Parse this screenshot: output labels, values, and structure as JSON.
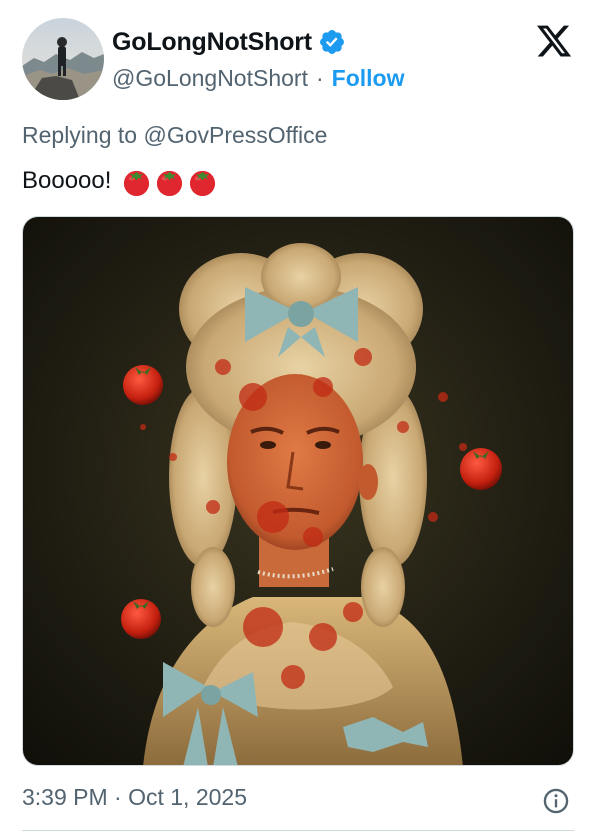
{
  "author": {
    "display_name": "GoLongNotShort",
    "handle": "@GoLongNotShort",
    "separator": "·",
    "follow_label": "Follow",
    "verified": true
  },
  "reply": {
    "prefix": "Replying to ",
    "mention": "@GovPressOffice"
  },
  "tweet": {
    "text": "Booooo!",
    "emoji": [
      "tomato",
      "tomato",
      "tomato"
    ]
  },
  "media": {
    "description_icon": "portrait-image"
  },
  "footer": {
    "timestamp": "3:39 PM · Oct 1, 2025",
    "info_icon": "info-icon"
  },
  "colors": {
    "accent": "#1d9bf0",
    "secondary_text": "#536471",
    "primary_text": "#0f1419",
    "divider": "#cfd9de"
  }
}
